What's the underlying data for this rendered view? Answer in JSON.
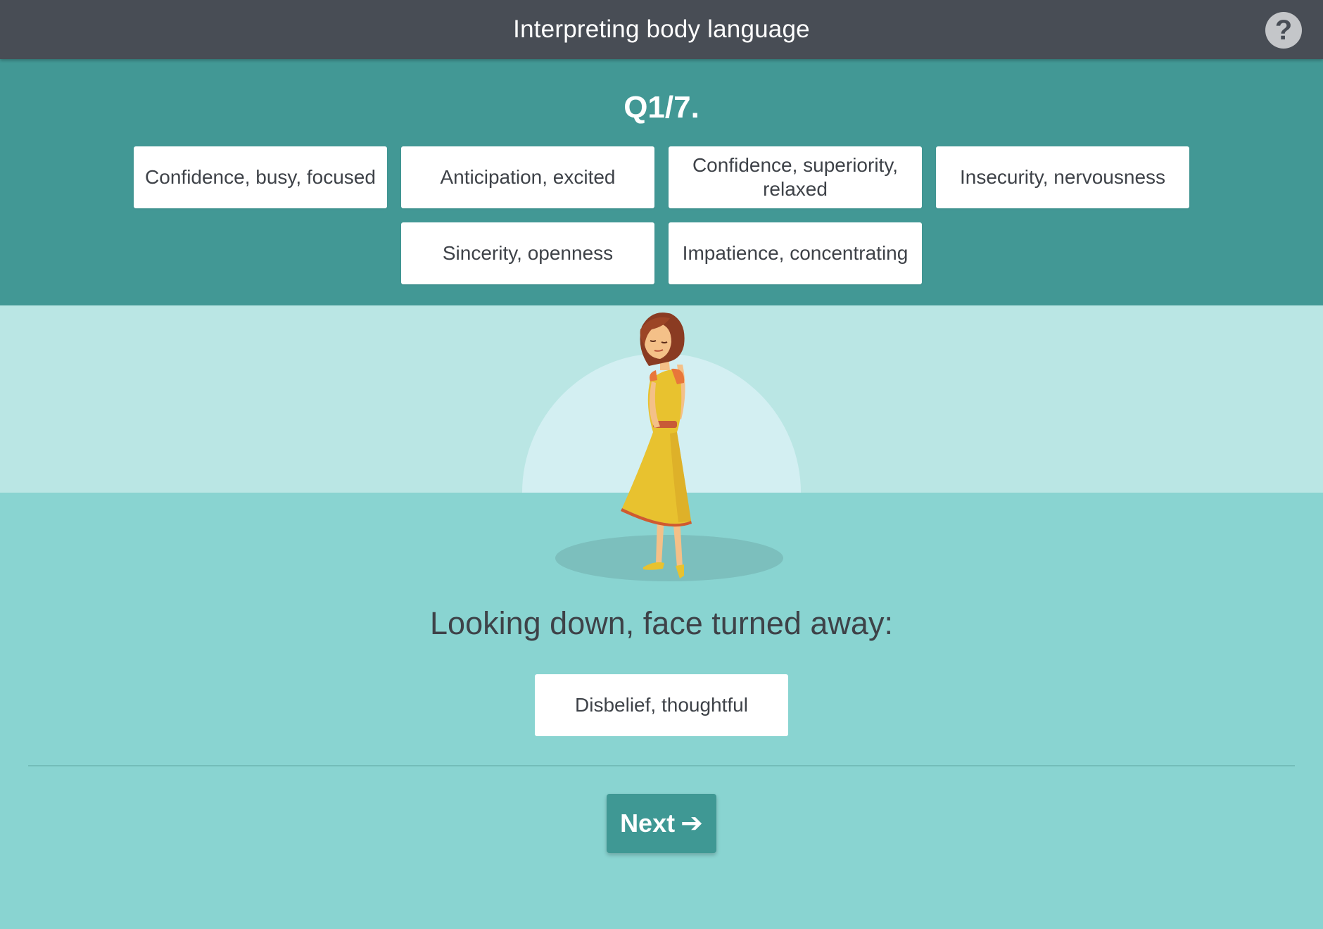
{
  "header": {
    "title": "Interpreting body language",
    "help_icon": "question-circle-icon"
  },
  "question": {
    "number": "Q1/7.",
    "options": [
      "Confidence, busy, focused",
      "Anticipation, excited",
      "Confidence, superiority, relaxed",
      "Insecurity, nervousness",
      "Sincerity, openness",
      "Impatience, concentrating"
    ]
  },
  "scene": {
    "illustration": "woman-in-yellow-dress-looking-down"
  },
  "prompt": {
    "text": "Looking down, face turned away:",
    "placed_answer": "Disbelief, thoughtful"
  },
  "footer": {
    "next_label": "Next",
    "next_icon": "arrow-right-icon"
  },
  "colors": {
    "header_bg": "#484d55",
    "question_bg": "#429895",
    "sky_bg": "#bae6e4",
    "ground_bg": "#89d4d1",
    "button_bg": "#3f9894",
    "dress": "#e8c22f"
  }
}
